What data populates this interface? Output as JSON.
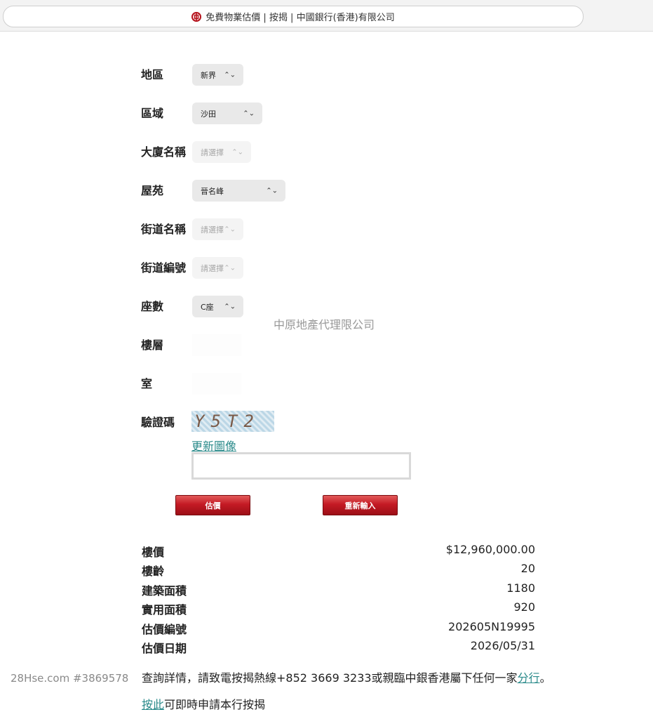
{
  "browser": {
    "title": "免費物業估價 | 按揭 | 中國銀行(香港)有限公司",
    "logo_icon": "boc-logo-icon",
    "brand_color": "#b5121b"
  },
  "form": {
    "region": {
      "label": "地區",
      "value": "新界"
    },
    "district": {
      "label": "區域",
      "value": "沙田"
    },
    "building": {
      "label": "大廈名稱",
      "placeholder": "請選擇"
    },
    "estate": {
      "label": "屋苑",
      "value": "晉名峰"
    },
    "street": {
      "label": "街道名稱",
      "placeholder": "請選擇"
    },
    "street_no": {
      "label": "街道編號",
      "placeholder": "請選擇"
    },
    "block": {
      "label": "座數",
      "value": "C座"
    },
    "floor": {
      "label": "樓層"
    },
    "unit": {
      "label": "室"
    },
    "captcha": {
      "label": "驗證碼",
      "image_text": "Y5T2",
      "refresh_label": "更新圖像",
      "input_value": ""
    },
    "submit_label": "估價",
    "reset_label": "重新輸入"
  },
  "watermark": "中原地產代理限公司",
  "results": [
    {
      "label": "樓價",
      "value": "$12,960,000.00"
    },
    {
      "label": "樓齡",
      "value": "20"
    },
    {
      "label": "建築面積",
      "value": "1180"
    },
    {
      "label": "實用面積",
      "value": "920"
    },
    {
      "label": "估價編號",
      "value": "202605N19995"
    },
    {
      "label": "估價日期",
      "value": "2026/05/31"
    }
  ],
  "footer": {
    "inquiry_prefix": "查詢詳情，請致電按揭熱線+852 3669 3233或親臨中銀香港屬下任何一家",
    "inquiry_link": "分行",
    "inquiry_suffix": "。",
    "next_link": "按此",
    "next_text": "可即時申請本行按揭"
  },
  "site_mark": "28Hse.com #3869578"
}
